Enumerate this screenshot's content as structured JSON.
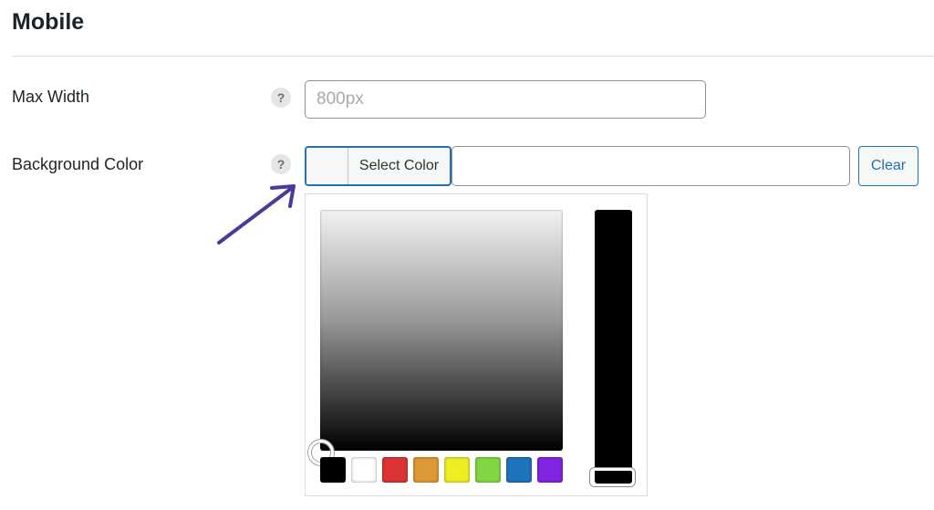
{
  "section": {
    "title": "Mobile"
  },
  "max_width": {
    "label": "Max Width",
    "help": "?",
    "placeholder": "800px",
    "value": ""
  },
  "background_color": {
    "label": "Background Color",
    "help": "?",
    "select_label": "Select Color",
    "hex_value": "",
    "clear_label": "Clear"
  },
  "picker": {
    "swatches": [
      "#000000",
      "#ffffff",
      "#dd3333",
      "#dd9933",
      "#eeee22",
      "#81d742",
      "#1e73be",
      "#8224e3"
    ]
  },
  "colors": {
    "accent": "#2271b1",
    "arrow": "#4b3a9e"
  }
}
